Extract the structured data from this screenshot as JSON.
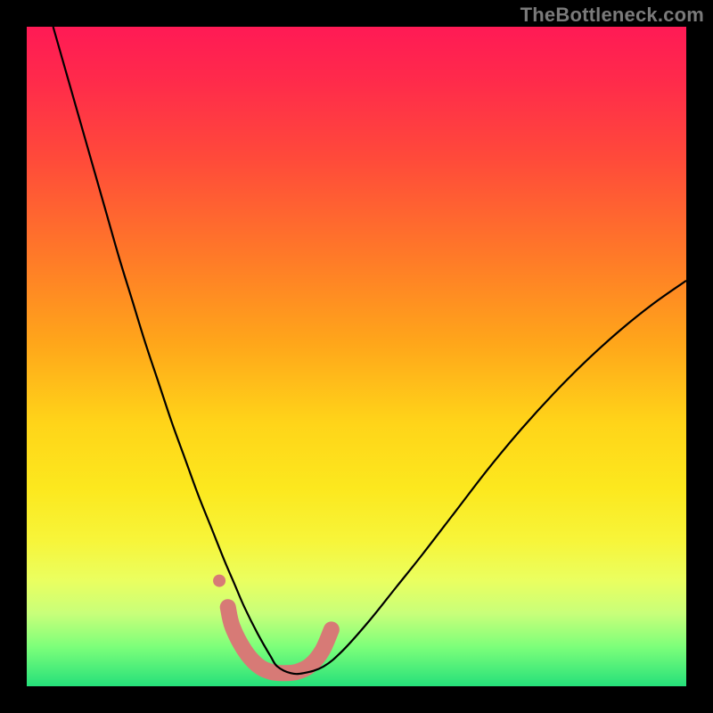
{
  "watermark": "TheBottleneck.com",
  "chart_data": {
    "type": "line",
    "title": "",
    "xlabel": "",
    "ylabel": "",
    "xlim": [
      0,
      100
    ],
    "ylim": [
      0,
      100
    ],
    "grid": false,
    "legend": false,
    "series": [
      {
        "name": "bottleneck-curve",
        "color": "#000000",
        "stroke_width": 2.2,
        "x": [
          4,
          6,
          8,
          10,
          12,
          14,
          16,
          18,
          20,
          22,
          24,
          26,
          28,
          30,
          31.5,
          33,
          35,
          37,
          38,
          40,
          42,
          45,
          48,
          52,
          56,
          60,
          65,
          70,
          75,
          80,
          85,
          90,
          95,
          100
        ],
        "y": [
          100,
          93,
          86,
          79,
          72,
          65,
          58.5,
          52,
          46,
          40,
          34.5,
          29,
          24,
          19,
          15.5,
          12,
          8,
          4.5,
          3,
          2,
          2,
          3,
          5.5,
          10,
          15,
          20,
          26.5,
          33,
          39,
          44.5,
          49.5,
          54,
          58,
          61.5
        ]
      },
      {
        "name": "highlight-band",
        "color": "#d77a76",
        "stroke_width": 18,
        "linecap": "round",
        "x": [
          30.5,
          31.2,
          33,
          35,
          37,
          39,
          41,
          43,
          44.8,
          46.2
        ],
        "y": [
          12,
          9,
          5.5,
          3.2,
          2.2,
          2,
          2.2,
          3.2,
          5.4,
          8.6
        ]
      },
      {
        "name": "highlight-dot",
        "type": "scatter",
        "color": "#d77a76",
        "radius": 7,
        "x": [
          29.2
        ],
        "y": [
          16
        ]
      }
    ]
  }
}
